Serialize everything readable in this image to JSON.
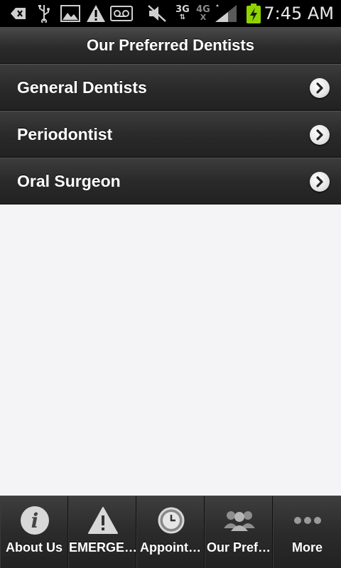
{
  "status_bar": {
    "time": "7:45 AM",
    "network_primary": "3G",
    "network_secondary": "4G",
    "icons": [
      "back-arrow-icon",
      "usb-icon",
      "image-icon",
      "warning-icon",
      "voicemail-icon",
      "mute-icon",
      "signal-icon",
      "battery-charging-icon"
    ]
  },
  "header": {
    "title": "Our Preferred Dentists"
  },
  "list": {
    "items": [
      {
        "label": "General Dentists"
      },
      {
        "label": "Periodontist"
      },
      {
        "label": "Oral Surgeon"
      }
    ]
  },
  "tabbar": {
    "tabs": [
      {
        "label": "About Us",
        "icon": "info-icon"
      },
      {
        "label": "EMERGE…",
        "icon": "warning-icon"
      },
      {
        "label": "Appoint…",
        "icon": "clock-icon"
      },
      {
        "label": "Our Pref…",
        "icon": "group-icon"
      },
      {
        "label": "More",
        "icon": "more-icon"
      }
    ]
  },
  "colors": {
    "status_bar": "#000000",
    "header_bg": "#2b2b2b",
    "list_bg": "#2a2a2a",
    "content_bg": "#f4f4f6",
    "battery_green": "#8fd400"
  }
}
